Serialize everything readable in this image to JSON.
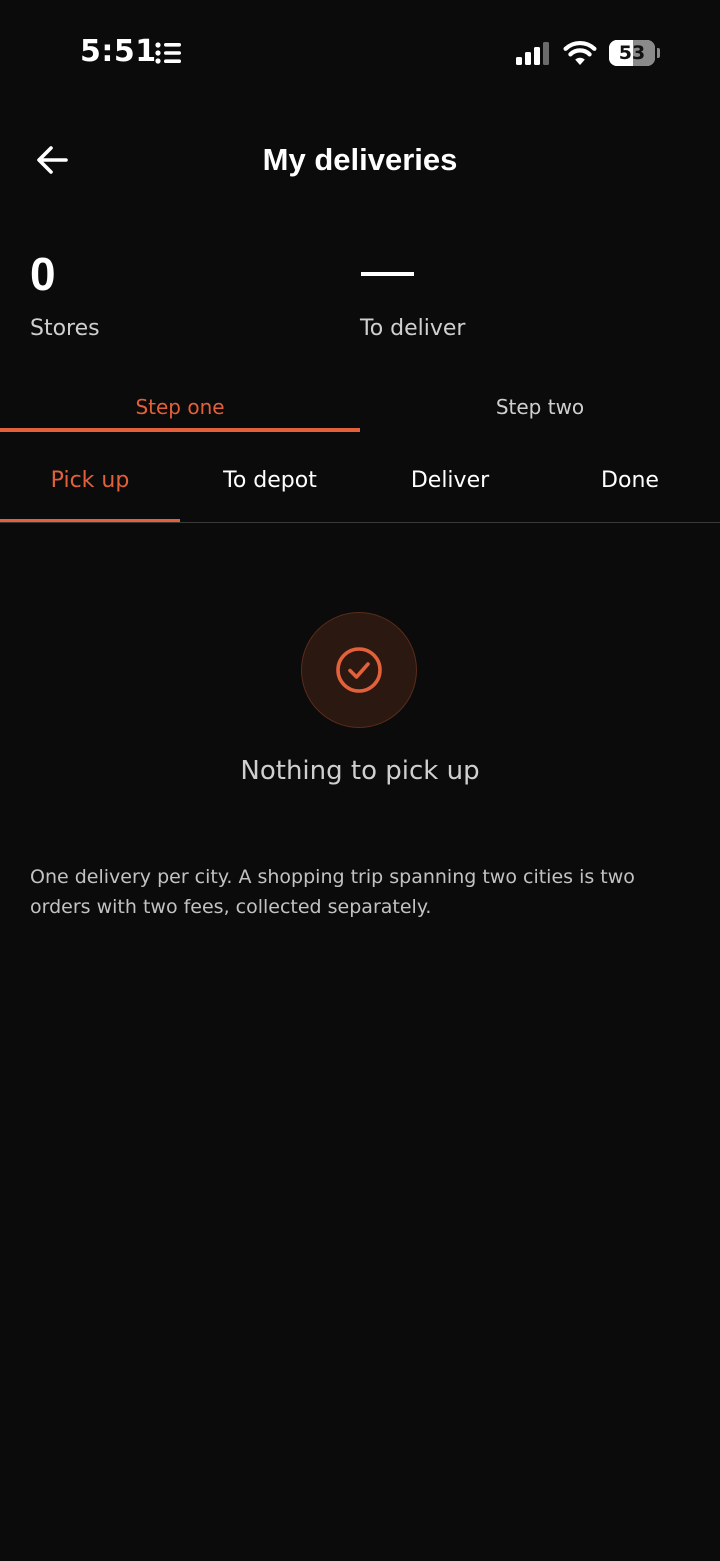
{
  "status_bar": {
    "time": "5:51",
    "battery_level": "53",
    "battery_fraction": 0.53,
    "icons": [
      "list-icon",
      "signal-icon",
      "wifi-icon",
      "battery-icon"
    ]
  },
  "header": {
    "title": "My deliveries",
    "back_icon": "arrow-left-icon"
  },
  "stats": {
    "stores": {
      "value": "0",
      "label": "Stores"
    },
    "to_deliver": {
      "value": "—",
      "label": "To deliver"
    }
  },
  "step_tabs": [
    {
      "label": "Step one",
      "active": true
    },
    {
      "label": "Step two",
      "active": false
    }
  ],
  "sub_tabs": [
    {
      "label": "Pick up",
      "active": true
    },
    {
      "label": "To depot",
      "active": false
    },
    {
      "label": "Deliver",
      "active": false
    },
    {
      "label": "Done",
      "active": false
    }
  ],
  "empty_state": {
    "icon": "check-circle-icon",
    "title": "Nothing to pick up"
  },
  "note": "One delivery per city. A shopping trip spanning two cities is two orders with two fees, collected separately.",
  "colors": {
    "background": "#0b0b0b",
    "accent": "#e2603a",
    "text_primary": "#ffffff",
    "text_secondary": "#cfcfcf",
    "divider": "#3a3a3a",
    "empty_circle_bg": "#2b1811"
  }
}
